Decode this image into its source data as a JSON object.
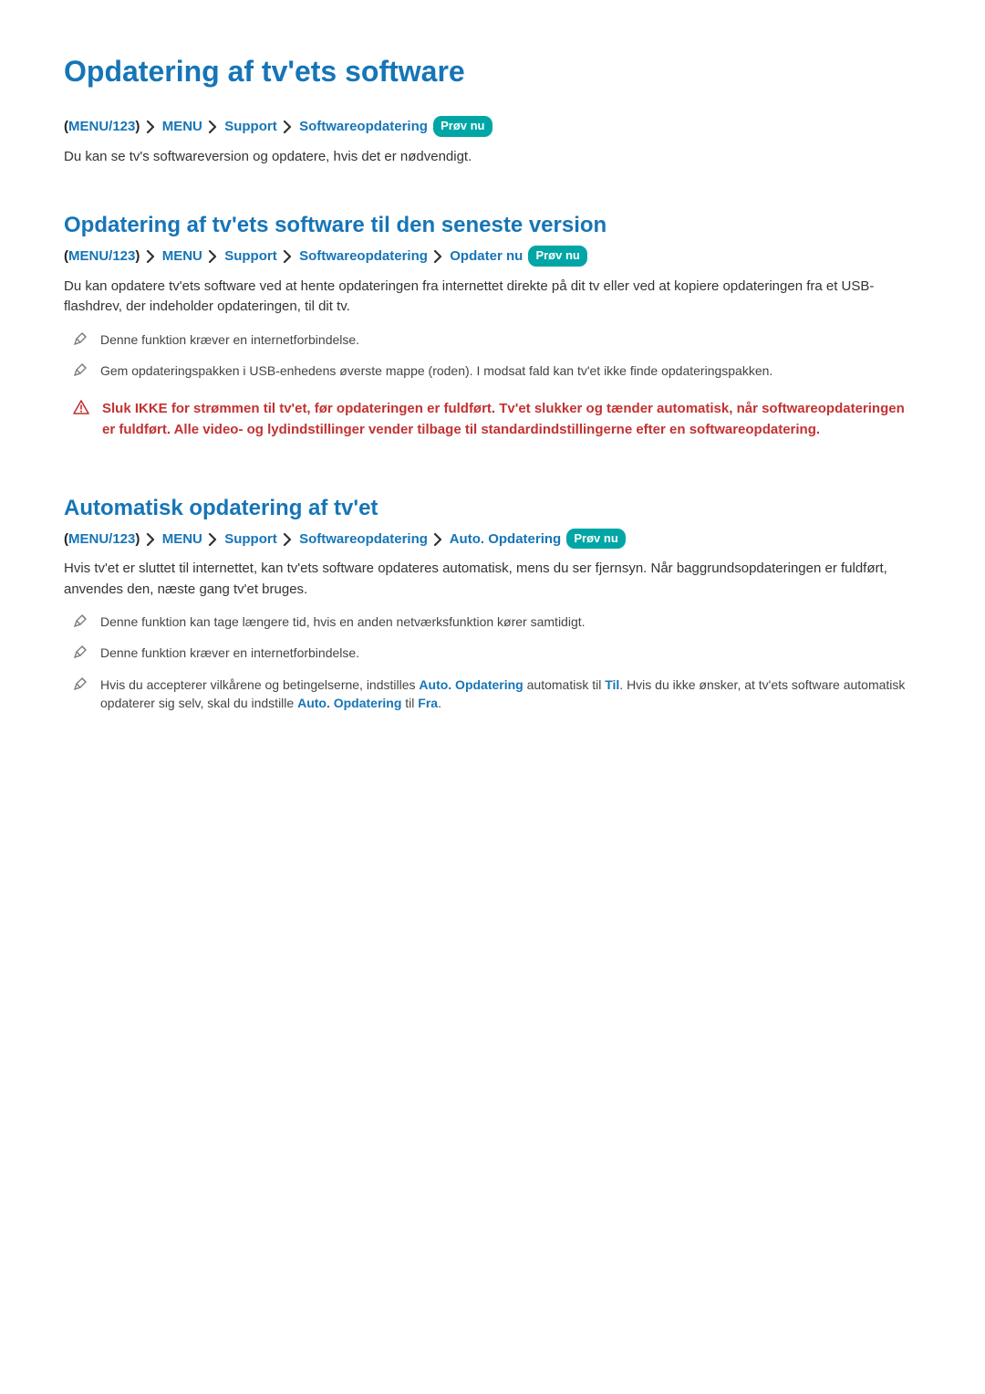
{
  "title": "Opdatering af tv'ets software",
  "nav1": {
    "paren_open": "(",
    "menu123": "MENU/123",
    "paren_close": ")",
    "menu": "MENU",
    "support": "Support",
    "software": "Softwareopdatering",
    "badge": "Prøv nu"
  },
  "intro": "Du kan se tv's softwareversion og opdatere, hvis det er nødvendigt.",
  "section1": {
    "heading": "Opdatering af tv'ets software til den seneste version",
    "nav": {
      "paren_open": "(",
      "menu123": "MENU/123",
      "paren_close": ")",
      "menu": "MENU",
      "support": "Support",
      "software": "Softwareopdatering",
      "updatenow": "Opdater nu",
      "badge": "Prøv nu"
    },
    "body": "Du kan opdatere tv'ets software ved at hente opdateringen fra internettet direkte på dit tv eller ved at kopiere opdateringen fra et USB-flashdrev, der indeholder opdateringen, til dit tv.",
    "note1": "Denne funktion kræver en internetforbindelse.",
    "note2": "Gem opdateringspakken i USB-enhedens øverste mappe (roden). I modsat fald kan tv'et ikke finde opdateringspakken.",
    "warn": "Sluk IKKE for strømmen til tv'et, før opdateringen er fuldført. Tv'et slukker og tænder automatisk, når softwareopdateringen er fuldført. Alle video- og lydindstillinger vender tilbage til standardindstillingerne efter en softwareopdatering."
  },
  "section2": {
    "heading": "Automatisk opdatering af tv'et",
    "nav": {
      "paren_open": "(",
      "menu123": "MENU/123",
      "paren_close": ")",
      "menu": "MENU",
      "support": "Support",
      "software": "Softwareopdatering",
      "auto": "Auto. Opdatering",
      "badge": "Prøv nu"
    },
    "body": "Hvis tv'et er sluttet til internettet, kan tv'ets software opdateres automatisk, mens du ser fjernsyn. Når baggrundsopdateringen er fuldført, anvendes den, næste gang tv'et bruges.",
    "note1": "Denne funktion kan tage længere tid, hvis en anden netværksfunktion kører samtidigt.",
    "note2": "Denne funktion kræver en internetforbindelse.",
    "note3": {
      "pre": "Hvis du accepterer vilkårene og betingelserne, indstilles ",
      "b1": "Auto. Opdatering",
      "mid1": " automatisk til ",
      "b2": "Til",
      "mid2": ". Hvis du ikke ønsker, at tv'ets software automatisk opdaterer sig selv, skal du indstille ",
      "b3": "Auto. Opdatering",
      "mid3": " til ",
      "b4": "Fra",
      "end": "."
    }
  }
}
